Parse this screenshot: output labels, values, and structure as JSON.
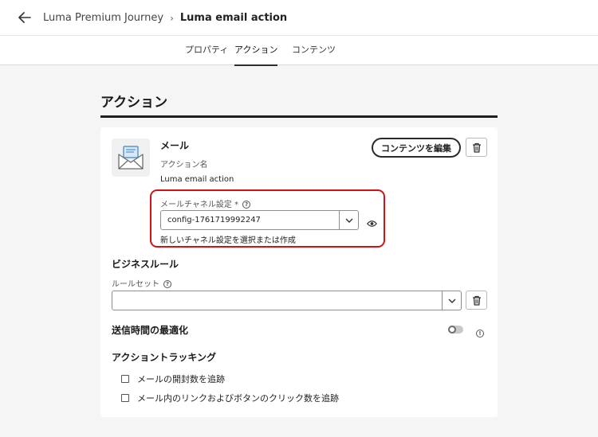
{
  "header": {
    "breadcrumb_parent": "Luma Premium Journey",
    "breadcrumb_separator": "›",
    "breadcrumb_current": "Luma email action"
  },
  "tabs": [
    {
      "label": "プロパティ",
      "active": false
    },
    {
      "label": "アクション",
      "active": true
    },
    {
      "label": "コンテンツ",
      "active": false
    }
  ],
  "page": {
    "title": "アクション"
  },
  "email": {
    "heading": "メール",
    "action_name_label": "アクション名",
    "action_name_value": "Luma email action",
    "edit_content_button": "コンテンツを編集",
    "channel_config_label": "メールチャネル設定 *",
    "channel_config_value": "config-1761719992247",
    "channel_config_help": "新しいチャネル設定を選択または作成"
  },
  "business_rules": {
    "heading": "ビジネスルール",
    "ruleset_label": "ルールセット",
    "ruleset_value": ""
  },
  "send_time": {
    "heading": "送信時間の最適化",
    "enabled": false
  },
  "tracking": {
    "heading": "アクショントラッキング",
    "options": [
      {
        "label": "メールの開封数を追跡",
        "checked": false
      },
      {
        "label": "メール内のリンクおよびボタンのクリック数を追跡",
        "checked": false
      }
    ]
  },
  "colors": {
    "highlight": "#d31313",
    "accent": "#1473e6"
  },
  "icons": [
    "back-arrow-icon",
    "chevron-right-icon",
    "email-envelope-icon",
    "delete-icon",
    "chevron-down-icon",
    "preview-eye-icon",
    "help-icon"
  ]
}
